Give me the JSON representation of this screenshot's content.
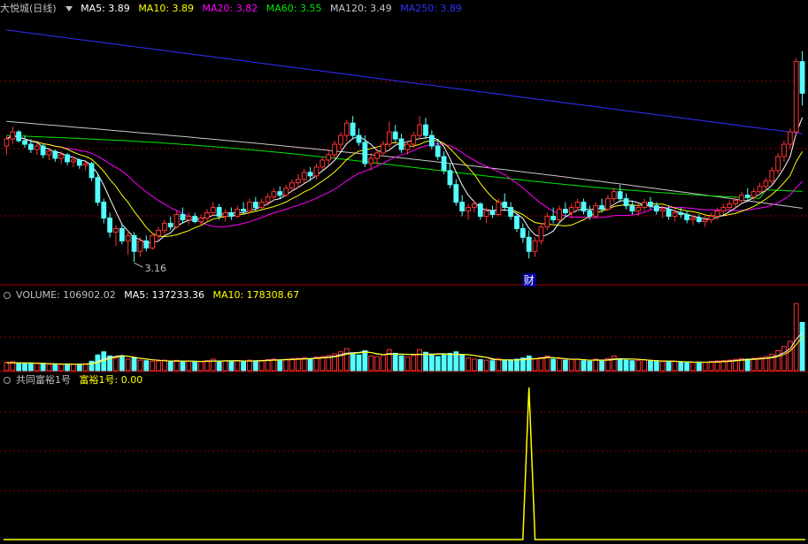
{
  "header_main": {
    "symbol": "大悦城(日线)",
    "ma5": "MA5: 3.89",
    "ma10": "MA10: 3.89",
    "ma20": "MA20: 3.82",
    "ma60": "MA60: 3.55",
    "ma120": "MA120: 3.49",
    "ma250": "MA250: 3.89"
  },
  "header_volume": {
    "label": "VOLUME: 106902.02",
    "ma5": "MA5: 137233.36",
    "ma10": "MA10: 178308.67"
  },
  "header_indicator": {
    "name": "共同富裕1号",
    "value": "富裕1号: 0.00"
  },
  "colors": {
    "up": "#ff3232",
    "down": "#54ffff",
    "ma5": "#ffffff",
    "ma10": "#ffff00",
    "ma20": "#ff00ff",
    "ma60": "#00e600",
    "ma120": "#c8c8c8",
    "ma250": "#3030ff",
    "grid": "#8b0000",
    "indicator": "#ffff00"
  },
  "chart_data": [
    {
      "type": "candlestick",
      "panel": "price",
      "low_annotation": "3.16",
      "event_marker": "财",
      "ohlc": [
        [
          3.82,
          3.88,
          3.77,
          3.86
        ],
        [
          3.86,
          3.93,
          3.83,
          3.9
        ],
        [
          3.9,
          3.91,
          3.84,
          3.85
        ],
        [
          3.85,
          3.88,
          3.81,
          3.83
        ],
        [
          3.83,
          3.86,
          3.78,
          3.8
        ],
        [
          3.8,
          3.84,
          3.77,
          3.82
        ],
        [
          3.82,
          3.83,
          3.75,
          3.77
        ],
        [
          3.77,
          3.81,
          3.74,
          3.79
        ],
        [
          3.79,
          3.8,
          3.73,
          3.75
        ],
        [
          3.75,
          3.79,
          3.72,
          3.77
        ],
        [
          3.77,
          3.78,
          3.71,
          3.73
        ],
        [
          3.73,
          3.76,
          3.7,
          3.74
        ],
        [
          3.74,
          3.75,
          3.69,
          3.71
        ],
        [
          3.71,
          3.73,
          3.68,
          3.72
        ],
        [
          3.72,
          3.73,
          3.62,
          3.64
        ],
        [
          3.64,
          3.66,
          3.48,
          3.5
        ],
        [
          3.5,
          3.52,
          3.38,
          3.41
        ],
        [
          3.41,
          3.44,
          3.3,
          3.33
        ],
        [
          3.33,
          3.37,
          3.25,
          3.35
        ],
        [
          3.35,
          3.38,
          3.26,
          3.28
        ],
        [
          3.28,
          3.34,
          3.2,
          3.31
        ],
        [
          3.31,
          3.33,
          3.16,
          3.22
        ],
        [
          3.22,
          3.3,
          3.19,
          3.28
        ],
        [
          3.28,
          3.31,
          3.22,
          3.24
        ],
        [
          3.24,
          3.33,
          3.23,
          3.31
        ],
        [
          3.31,
          3.36,
          3.28,
          3.34
        ],
        [
          3.34,
          3.4,
          3.32,
          3.38
        ],
        [
          3.38,
          3.42,
          3.34,
          3.36
        ],
        [
          3.36,
          3.45,
          3.35,
          3.43
        ],
        [
          3.43,
          3.47,
          3.38,
          3.4
        ],
        [
          3.4,
          3.44,
          3.37,
          3.42
        ],
        [
          3.42,
          3.44,
          3.38,
          3.39
        ],
        [
          3.39,
          3.43,
          3.37,
          3.41
        ],
        [
          3.41,
          3.46,
          3.39,
          3.44
        ],
        [
          3.44,
          3.5,
          3.42,
          3.47
        ],
        [
          3.47,
          3.49,
          3.4,
          3.42
        ],
        [
          3.42,
          3.46,
          3.39,
          3.44
        ],
        [
          3.44,
          3.47,
          3.4,
          3.42
        ],
        [
          3.42,
          3.48,
          3.41,
          3.46
        ],
        [
          3.46,
          3.5,
          3.43,
          3.45
        ],
        [
          3.45,
          3.52,
          3.44,
          3.5
        ],
        [
          3.5,
          3.53,
          3.45,
          3.47
        ],
        [
          3.47,
          3.52,
          3.46,
          3.5
        ],
        [
          3.5,
          3.55,
          3.48,
          3.53
        ],
        [
          3.53,
          3.58,
          3.51,
          3.56
        ],
        [
          3.56,
          3.59,
          3.52,
          3.54
        ],
        [
          3.54,
          3.6,
          3.53,
          3.58
        ],
        [
          3.58,
          3.63,
          3.56,
          3.61
        ],
        [
          3.61,
          3.66,
          3.58,
          3.63
        ],
        [
          3.63,
          3.69,
          3.61,
          3.67
        ],
        [
          3.67,
          3.7,
          3.62,
          3.65
        ],
        [
          3.65,
          3.72,
          3.63,
          3.7
        ],
        [
          3.7,
          3.76,
          3.68,
          3.74
        ],
        [
          3.74,
          3.8,
          3.71,
          3.77
        ],
        [
          3.77,
          3.85,
          3.75,
          3.83
        ],
        [
          3.83,
          3.9,
          3.8,
          3.88
        ],
        [
          3.88,
          3.97,
          3.85,
          3.95
        ],
        [
          3.95,
          3.99,
          3.86,
          3.88
        ],
        [
          3.88,
          3.92,
          3.82,
          3.84
        ],
        [
          3.84,
          3.88,
          3.7,
          3.72
        ],
        [
          3.72,
          3.78,
          3.68,
          3.75
        ],
        [
          3.75,
          3.8,
          3.71,
          3.78
        ],
        [
          3.78,
          3.85,
          3.76,
          3.83
        ],
        [
          3.83,
          3.96,
          3.81,
          3.9
        ],
        [
          3.9,
          3.94,
          3.84,
          3.86
        ],
        [
          3.86,
          3.89,
          3.78,
          3.8
        ],
        [
          3.8,
          3.85,
          3.77,
          3.83
        ],
        [
          3.83,
          3.9,
          3.81,
          3.88
        ],
        [
          3.88,
          3.99,
          3.86,
          3.94
        ],
        [
          3.94,
          3.98,
          3.86,
          3.88
        ],
        [
          3.88,
          3.91,
          3.8,
          3.82
        ],
        [
          3.82,
          3.86,
          3.74,
          3.76
        ],
        [
          3.76,
          3.79,
          3.66,
          3.68
        ],
        [
          3.68,
          3.72,
          3.58,
          3.6
        ],
        [
          3.6,
          3.63,
          3.48,
          3.5
        ],
        [
          3.5,
          3.54,
          3.42,
          3.45
        ],
        [
          3.45,
          3.49,
          3.4,
          3.47
        ],
        [
          3.47,
          3.51,
          3.44,
          3.49
        ],
        [
          3.49,
          3.5,
          3.4,
          3.42
        ],
        [
          3.42,
          3.47,
          3.38,
          3.45
        ],
        [
          3.45,
          3.48,
          3.41,
          3.43
        ],
        [
          3.43,
          3.52,
          3.42,
          3.5
        ],
        [
          3.5,
          3.55,
          3.45,
          3.47
        ],
        [
          3.47,
          3.5,
          3.4,
          3.42
        ],
        [
          3.42,
          3.44,
          3.33,
          3.35
        ],
        [
          3.35,
          3.38,
          3.27,
          3.3
        ],
        [
          3.3,
          3.34,
          3.18,
          3.22
        ],
        [
          3.22,
          3.3,
          3.19,
          3.28
        ],
        [
          3.28,
          3.38,
          3.26,
          3.36
        ],
        [
          3.36,
          3.44,
          3.34,
          3.42
        ],
        [
          3.42,
          3.47,
          3.38,
          3.4
        ],
        [
          3.4,
          3.48,
          3.39,
          3.46
        ],
        [
          3.46,
          3.5,
          3.42,
          3.44
        ],
        [
          3.44,
          3.49,
          3.41,
          3.47
        ],
        [
          3.47,
          3.52,
          3.45,
          3.5
        ],
        [
          3.5,
          3.52,
          3.43,
          3.45
        ],
        [
          3.45,
          3.48,
          3.4,
          3.42
        ],
        [
          3.42,
          3.5,
          3.41,
          3.48
        ],
        [
          3.48,
          3.52,
          3.44,
          3.46
        ],
        [
          3.46,
          3.54,
          3.45,
          3.52
        ],
        [
          3.52,
          3.58,
          3.5,
          3.56
        ],
        [
          3.56,
          3.6,
          3.5,
          3.52
        ],
        [
          3.52,
          3.55,
          3.46,
          3.48
        ],
        [
          3.48,
          3.51,
          3.43,
          3.45
        ],
        [
          3.45,
          3.49,
          3.42,
          3.47
        ],
        [
          3.47,
          3.52,
          3.45,
          3.5
        ],
        [
          3.5,
          3.53,
          3.46,
          3.48
        ],
        [
          3.48,
          3.5,
          3.43,
          3.45
        ],
        [
          3.45,
          3.48,
          3.41,
          3.46
        ],
        [
          3.46,
          3.48,
          3.4,
          3.42
        ],
        [
          3.42,
          3.46,
          3.39,
          3.44
        ],
        [
          3.44,
          3.47,
          3.41,
          3.43
        ],
        [
          3.43,
          3.45,
          3.38,
          3.4
        ],
        [
          3.4,
          3.43,
          3.37,
          3.41
        ],
        [
          3.41,
          3.43,
          3.38,
          3.39
        ],
        [
          3.39,
          3.42,
          3.36,
          3.4
        ],
        [
          3.4,
          3.44,
          3.38,
          3.42
        ],
        [
          3.42,
          3.47,
          3.4,
          3.45
        ],
        [
          3.45,
          3.49,
          3.43,
          3.47
        ],
        [
          3.47,
          3.51,
          3.45,
          3.49
        ],
        [
          3.49,
          3.53,
          3.47,
          3.51
        ],
        [
          3.51,
          3.56,
          3.49,
          3.54
        ],
        [
          3.54,
          3.58,
          3.5,
          3.53
        ],
        [
          3.53,
          3.58,
          3.51,
          3.56
        ],
        [
          3.56,
          3.61,
          3.54,
          3.59
        ],
        [
          3.59,
          3.64,
          3.56,
          3.62
        ],
        [
          3.62,
          3.7,
          3.6,
          3.68
        ],
        [
          3.68,
          3.78,
          3.66,
          3.76
        ],
        [
          3.76,
          3.85,
          3.73,
          3.83
        ],
        [
          3.83,
          3.92,
          3.8,
          3.9
        ],
        [
          3.9,
          4.32,
          3.88,
          4.3
        ],
        [
          4.3,
          4.36,
          4.05,
          4.12
        ]
      ],
      "price_range": [
        3.05,
        4.55
      ]
    },
    {
      "type": "bar",
      "panel": "volume",
      "volume_range": [
        0,
        650000
      ],
      "values": [
        80000,
        85000,
        70000,
        72000,
        68000,
        65000,
        70000,
        60000,
        62000,
        58000,
        64000,
        60000,
        63000,
        66000,
        90000,
        150000,
        180000,
        140000,
        120000,
        130000,
        110000,
        125000,
        100000,
        95000,
        90000,
        92000,
        100000,
        85000,
        98000,
        88000,
        90000,
        86000,
        85000,
        95000,
        110000,
        90000,
        92000,
        88000,
        96000,
        90000,
        100000,
        95000,
        98000,
        105000,
        110000,
        102000,
        108000,
        115000,
        118000,
        125000,
        115000,
        130000,
        135000,
        145000,
        160000,
        180000,
        210000,
        170000,
        150000,
        190000,
        140000,
        135000,
        150000,
        200000,
        165000,
        140000,
        130000,
        145000,
        200000,
        175000,
        150000,
        135000,
        150000,
        165000,
        180000,
        150000,
        120000,
        110000,
        105000,
        100000,
        95000,
        115000,
        100000,
        95000,
        110000,
        120000,
        140000,
        110000,
        125000,
        140000,
        110000,
        115000,
        100000,
        105000,
        110000,
        95000,
        90000,
        110000,
        95000,
        115000,
        140000,
        110000,
        100000,
        95000,
        98000,
        105000,
        95000,
        90000,
        85000,
        88000,
        86000,
        82000,
        80000,
        78000,
        82000,
        80000,
        88000,
        92000,
        96000,
        100000,
        108000,
        115000,
        110000,
        118000,
        125000,
        135000,
        155000,
        190000,
        230000,
        280000,
        640000,
        460000
      ],
      "ma5": [
        75000,
        75000,
        75000,
        74000,
        74000,
        72000,
        70000,
        67000,
        65000,
        63000,
        63000,
        62000,
        61000,
        62000,
        69000,
        87000,
        110000,
        125000,
        136000,
        144000,
        136000,
        125000,
        117000,
        110000,
        104000,
        100000,
        95000,
        92000,
        93000,
        92000,
        92000,
        90000,
        89000,
        90000,
        93000,
        92000,
        95000,
        95000,
        96000,
        93000,
        93000,
        94000,
        96000,
        100000,
        102000,
        104000,
        106000,
        108000,
        111000,
        114000,
        116000,
        121000,
        125000,
        130000,
        137000,
        153000,
        166000,
        170000,
        174000,
        182000,
        172000,
        158000,
        153000,
        163000,
        158000,
        158000,
        156000,
        156000,
        156000,
        158000,
        158000,
        160000,
        162000,
        155000,
        156000,
        156000,
        153000,
        145000,
        133000,
        127000,
        106000,
        105000,
        103000,
        103000,
        104000,
        108000,
        116000,
        115000,
        121000,
        129000,
        125000,
        120000,
        112000,
        110000,
        110000,
        105000,
        100000,
        102000,
        101000,
        103000,
        111000,
        114000,
        112000,
        112000,
        109000,
        103000,
        99000,
        96000,
        92000,
        92000,
        90000,
        86000,
        84000,
        82000,
        81000,
        81000,
        82000,
        84000,
        88000,
        92000,
        97000,
        103000,
        106000,
        111000,
        115000,
        121000,
        129000,
        145000,
        171000,
        208000,
        300000,
        360000
      ]
    },
    {
      "type": "line",
      "panel": "indicator",
      "series": [
        {
          "name": "富裕1号",
          "spike_index": 86,
          "spike_value": 1
        }
      ],
      "ylim": [
        0,
        1
      ]
    }
  ]
}
